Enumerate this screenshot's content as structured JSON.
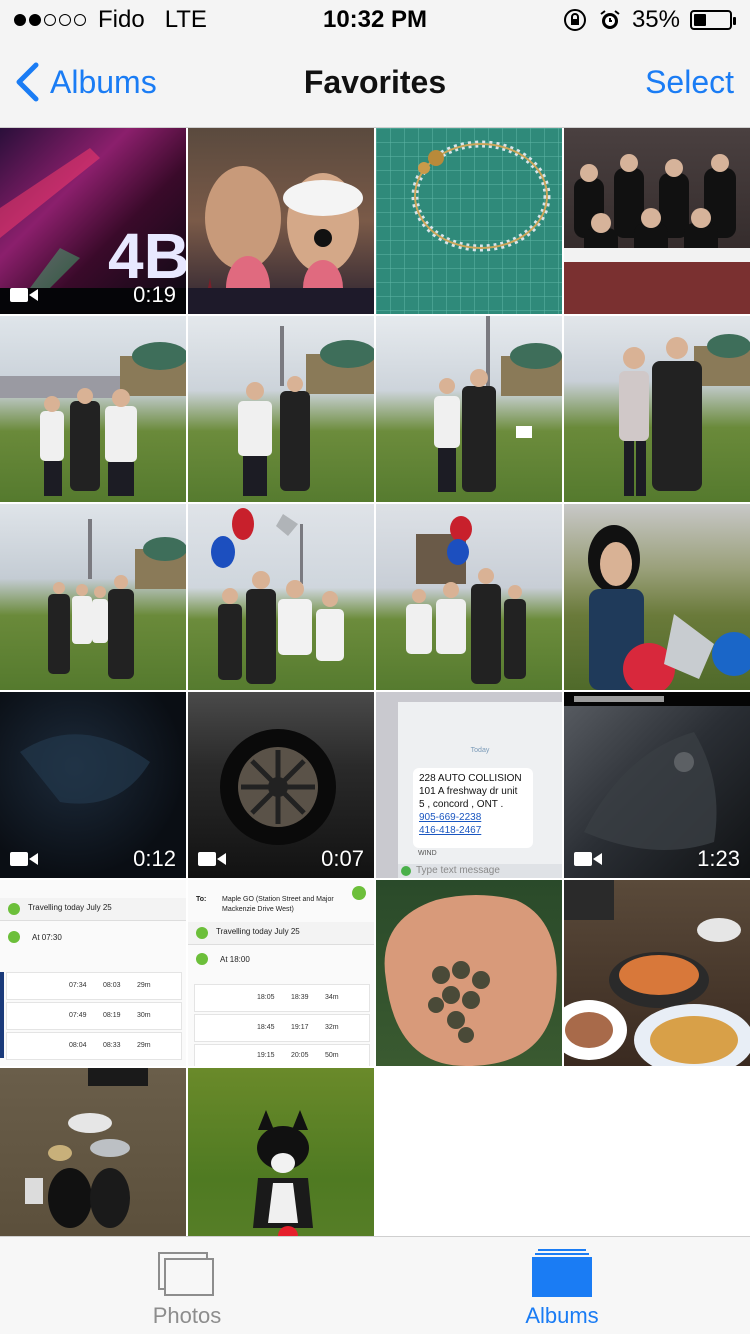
{
  "status_bar": {
    "carrier": "Fido",
    "network": "LTE",
    "time": "10:32 PM",
    "battery": "35%",
    "battery_level": 0.35,
    "signal_bars": 2,
    "signal_total": 5
  },
  "nav": {
    "back_label": "Albums",
    "title": "Favorites",
    "select_label": "Select"
  },
  "grid": {
    "rows": [
      [
        {
          "kind": "video",
          "duration": "0:19",
          "desc": "concert"
        },
        {
          "kind": "photo",
          "desc": "selfie-filter"
        },
        {
          "kind": "photo",
          "desc": "bracelet"
        },
        {
          "kind": "photo",
          "desc": "graduates-seated"
        }
      ],
      [
        {
          "kind": "photo",
          "desc": "graduation-field"
        },
        {
          "kind": "photo",
          "desc": "graduation-field"
        },
        {
          "kind": "photo",
          "desc": "graduation-field"
        },
        {
          "kind": "photo",
          "desc": "graduation-field"
        }
      ],
      [
        {
          "kind": "photo",
          "desc": "graduation-group"
        },
        {
          "kind": "photo",
          "desc": "graduation-balloons"
        },
        {
          "kind": "photo",
          "desc": "graduation-balloons"
        },
        {
          "kind": "photo",
          "desc": "girl-balloons"
        }
      ],
      [
        {
          "kind": "video",
          "duration": "0:12",
          "desc": "dark-night"
        },
        {
          "kind": "video",
          "duration": "0:07",
          "desc": "car-wheel"
        },
        {
          "kind": "photo",
          "desc": "text-message",
          "lines": [
            "Today",
            "228 AUTO COLLISION",
            "101 A freshway  dr unit",
            "5 , concord , ONT .",
            "905-669-2238",
            "416-418-2467",
            "WIND",
            "Type text message"
          ]
        },
        {
          "kind": "video",
          "duration": "1:23",
          "desc": "night-camera"
        }
      ],
      [
        {
          "kind": "photo",
          "desc": "transit-schedule",
          "lines": [
            "Travelling today July 25",
            "At 07:30",
            "07:34",
            "08:03",
            "29m",
            "07:49",
            "08:19",
            "30m",
            "08:04",
            "08:33",
            "29m"
          ]
        },
        {
          "kind": "photo",
          "desc": "transit-schedule",
          "lines": [
            "To:",
            "Maple GO (Station Street and Major",
            "Mackenzie Drive West)",
            "Travelling today July 25",
            "At 18:00",
            "18:05",
            "18:39",
            "34m",
            "18:45",
            "19:17",
            "32m",
            "19:15",
            "20:05",
            "50m"
          ]
        },
        {
          "kind": "photo",
          "desc": "tea-in-hand"
        },
        {
          "kind": "photo",
          "desc": "food-table"
        }
      ],
      [
        {
          "kind": "photo",
          "desc": "shoes-cans"
        },
        {
          "kind": "photo",
          "desc": "dog-lawn"
        }
      ]
    ]
  },
  "tabbar": {
    "photos_label": "Photos",
    "albums_label": "Albums"
  }
}
